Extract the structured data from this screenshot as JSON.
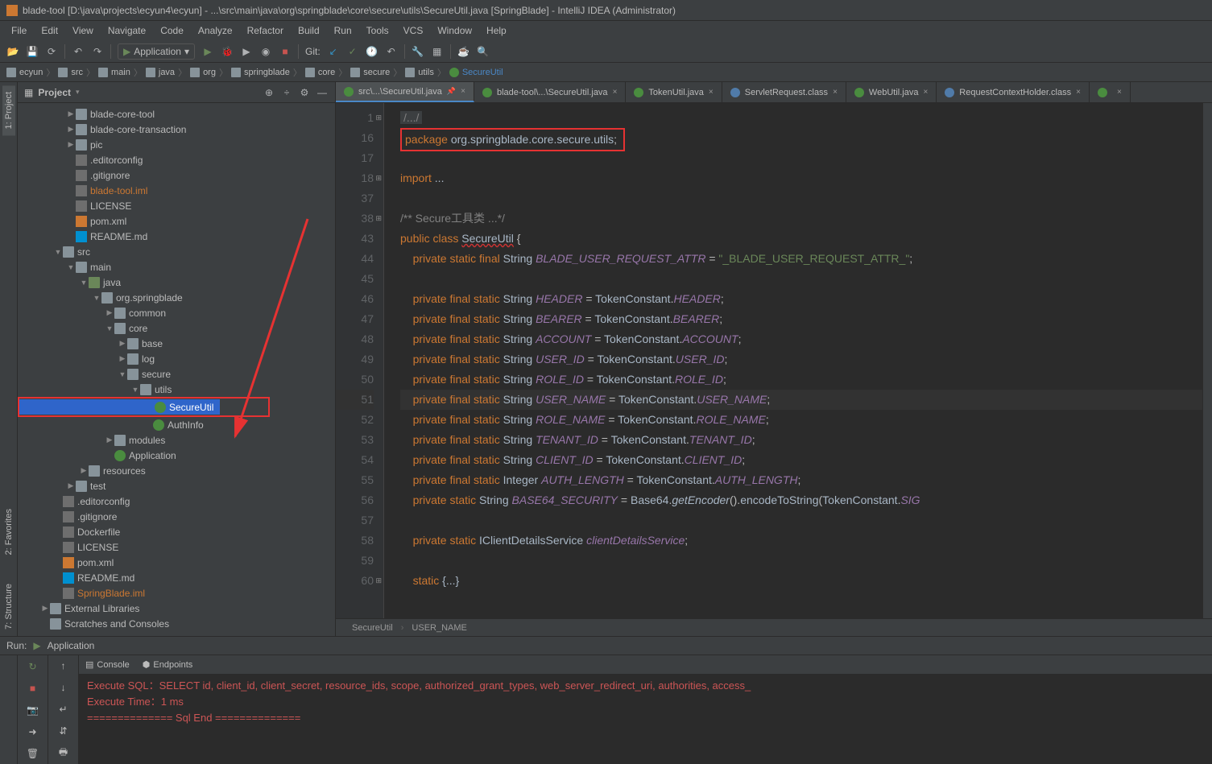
{
  "titlebar": "blade-tool [D:\\java\\projects\\ecyun4\\ecyun] - ...\\src\\main\\java\\org\\springblade\\core\\secure\\utils\\SecureUtil.java [SpringBlade] - IntelliJ IDEA (Administrator)",
  "menus": [
    "File",
    "Edit",
    "View",
    "Navigate",
    "Code",
    "Analyze",
    "Refactor",
    "Build",
    "Run",
    "Tools",
    "VCS",
    "Window",
    "Help"
  ],
  "toolbar": {
    "run_config": "Application",
    "git_label": "Git:"
  },
  "breadcrumb": [
    {
      "icon": "folder",
      "label": "ecyun"
    },
    {
      "icon": "folder",
      "label": "src"
    },
    {
      "icon": "folder",
      "label": "main"
    },
    {
      "icon": "folder",
      "label": "java"
    },
    {
      "icon": "folder",
      "label": "org"
    },
    {
      "icon": "folder",
      "label": "springblade"
    },
    {
      "icon": "folder",
      "label": "core"
    },
    {
      "icon": "folder",
      "label": "secure"
    },
    {
      "icon": "folder",
      "label": "utils"
    },
    {
      "icon": "class",
      "label": "SecureUtil"
    }
  ],
  "panel_title": "Project",
  "left_tabs": [
    "1: Project"
  ],
  "left_bottom_tabs": [
    "2: Favorites",
    "7: Structure"
  ],
  "tree": [
    {
      "d": 3,
      "a": "r",
      "i": "folder",
      "l": "blade-core-tool"
    },
    {
      "d": 3,
      "a": "r",
      "i": "folder",
      "l": "blade-core-transaction"
    },
    {
      "d": 3,
      "a": "r",
      "i": "folder",
      "l": "pic"
    },
    {
      "d": 3,
      "a": "",
      "i": "file",
      "l": ".editorconfig"
    },
    {
      "d": 3,
      "a": "",
      "i": "file",
      "l": ".gitignore"
    },
    {
      "d": 3,
      "a": "",
      "i": "file",
      "l": "blade-tool.iml",
      "c": "brown"
    },
    {
      "d": 3,
      "a": "",
      "i": "file",
      "l": "LICENSE"
    },
    {
      "d": 3,
      "a": "",
      "i": "xml",
      "l": "pom.xml"
    },
    {
      "d": 3,
      "a": "",
      "i": "md",
      "l": "README.md"
    },
    {
      "d": 2,
      "a": "d",
      "i": "folder",
      "l": "src"
    },
    {
      "d": 3,
      "a": "d",
      "i": "folder",
      "l": "main"
    },
    {
      "d": 4,
      "a": "d",
      "i": "folder-src",
      "l": "java"
    },
    {
      "d": 5,
      "a": "d",
      "i": "folder",
      "l": "org.springblade"
    },
    {
      "d": 6,
      "a": "r",
      "i": "folder",
      "l": "common"
    },
    {
      "d": 6,
      "a": "d",
      "i": "folder",
      "l": "core"
    },
    {
      "d": 7,
      "a": "r",
      "i": "folder",
      "l": "base"
    },
    {
      "d": 7,
      "a": "r",
      "i": "folder",
      "l": "log"
    },
    {
      "d": 7,
      "a": "d",
      "i": "folder",
      "l": "secure"
    },
    {
      "d": 8,
      "a": "d",
      "i": "folder",
      "l": "utils"
    },
    {
      "d": 9,
      "a": "",
      "i": "class-c",
      "l": "SecureUtil",
      "sel": true,
      "box": true
    },
    {
      "d": 9,
      "a": "",
      "i": "class-c",
      "l": "AuthInfo"
    },
    {
      "d": 6,
      "a": "r",
      "i": "folder",
      "l": "modules"
    },
    {
      "d": 6,
      "a": "",
      "i": "class-green",
      "l": "Application"
    },
    {
      "d": 4,
      "a": "r",
      "i": "folder",
      "l": "resources"
    },
    {
      "d": 3,
      "a": "r",
      "i": "folder",
      "l": "test"
    },
    {
      "d": 2,
      "a": "",
      "i": "file",
      "l": ".editorconfig"
    },
    {
      "d": 2,
      "a": "",
      "i": "file",
      "l": ".gitignore"
    },
    {
      "d": 2,
      "a": "",
      "i": "file",
      "l": "Dockerfile"
    },
    {
      "d": 2,
      "a": "",
      "i": "file",
      "l": "LICENSE"
    },
    {
      "d": 2,
      "a": "",
      "i": "xml",
      "l": "pom.xml"
    },
    {
      "d": 2,
      "a": "",
      "i": "md",
      "l": "README.md"
    },
    {
      "d": 2,
      "a": "",
      "i": "file",
      "l": "SpringBlade.iml",
      "c": "brown"
    },
    {
      "d": 1,
      "a": "r",
      "i": "folder",
      "l": "External Libraries"
    },
    {
      "d": 1,
      "a": "",
      "i": "folder",
      "l": "Scratches and Consoles"
    }
  ],
  "tabs": [
    {
      "i": "class",
      "l": "src\\...\\SecureUtil.java",
      "active": true,
      "pinned": true
    },
    {
      "i": "class",
      "l": "blade-tool\\...\\SecureUtil.java"
    },
    {
      "i": "class",
      "l": "TokenUtil.java"
    },
    {
      "i": "java",
      "l": "ServletRequest.class"
    },
    {
      "i": "class",
      "l": "WebUtil.java"
    },
    {
      "i": "java",
      "l": "RequestContextHolder.class"
    },
    {
      "i": "class",
      "l": ""
    }
  ],
  "code_lines": [
    {
      "n": 1,
      "t": "comment_block",
      "fold": 1
    },
    {
      "n": 16,
      "t": "package",
      "box": true
    },
    {
      "n": 17,
      "t": "blank"
    },
    {
      "n": 18,
      "t": "import",
      "fold": 1
    },
    {
      "n": 37,
      "t": "blank"
    },
    {
      "n": 38,
      "t": "doccomment",
      "fold": 1
    },
    {
      "n": 43,
      "t": "classdecl"
    },
    {
      "n": 44,
      "t": "field_str",
      "name": "BLADE_USER_REQUEST_ATTR",
      "mods": "private static final",
      "val": "\"_BLADE_USER_REQUEST_ATTR_\""
    },
    {
      "n": 45,
      "t": "blank"
    },
    {
      "n": 46,
      "t": "field_const",
      "name": "HEADER",
      "mods": "private final static",
      "ty": "String",
      "src": "TokenConstant",
      "srcf": "HEADER"
    },
    {
      "n": 47,
      "t": "field_const",
      "name": "BEARER",
      "mods": "private final static",
      "ty": "String",
      "src": "TokenConstant",
      "srcf": "BEARER"
    },
    {
      "n": 48,
      "t": "field_const",
      "name": "ACCOUNT",
      "mods": "private final static",
      "ty": "String",
      "src": "TokenConstant",
      "srcf": "ACCOUNT"
    },
    {
      "n": 49,
      "t": "field_const",
      "name": "USER_ID",
      "mods": "private final static",
      "ty": "String",
      "src": "TokenConstant",
      "srcf": "USER_ID"
    },
    {
      "n": 50,
      "t": "field_const",
      "name": "ROLE_ID",
      "mods": "private final static",
      "ty": "String",
      "src": "TokenConstant",
      "srcf": "ROLE_ID"
    },
    {
      "n": 51,
      "t": "field_const",
      "name": "USER_NAME",
      "mods": "private final static",
      "ty": "String",
      "src": "TokenConstant",
      "srcf": "USER_NAME",
      "hl": true
    },
    {
      "n": 52,
      "t": "field_const",
      "name": "ROLE_NAME",
      "mods": "private final static",
      "ty": "String",
      "src": "TokenConstant",
      "srcf": "ROLE_NAME"
    },
    {
      "n": 53,
      "t": "field_const",
      "name": "TENANT_ID",
      "mods": "private final static",
      "ty": "String",
      "src": "TokenConstant",
      "srcf": "TENANT_ID"
    },
    {
      "n": 54,
      "t": "field_const",
      "name": "CLIENT_ID",
      "mods": "private final static",
      "ty": "String",
      "src": "TokenConstant",
      "srcf": "CLIENT_ID"
    },
    {
      "n": 55,
      "t": "field_const",
      "name": "AUTH_LENGTH",
      "mods": "private final static",
      "ty": "Integer",
      "src": "TokenConstant",
      "srcf": "AUTH_LENGTH"
    },
    {
      "n": 56,
      "t": "base64"
    },
    {
      "n": 57,
      "t": "blank"
    },
    {
      "n": 58,
      "t": "service"
    },
    {
      "n": 59,
      "t": "blank"
    },
    {
      "n": 60,
      "t": "staticblock",
      "fold": 1
    }
  ],
  "editor_bc": [
    "SecureUtil",
    "USER_NAME"
  ],
  "run": {
    "label": "Run:",
    "config": "Application"
  },
  "bottom_tabs": [
    {
      "i": "console",
      "l": "Console"
    },
    {
      "i": "endpoints",
      "l": "Endpoints"
    }
  ],
  "console": [
    {
      "c": "red",
      "t": "Execute SQL：SELECT id, client_id, client_secret, resource_ids, scope, authorized_grant_types, web_server_redirect_uri, authorities, access_"
    },
    {
      "c": "red",
      "t": "Execute Time：1 ms"
    },
    {
      "c": "red",
      "t": "==============  Sql  End  =============="
    }
  ]
}
